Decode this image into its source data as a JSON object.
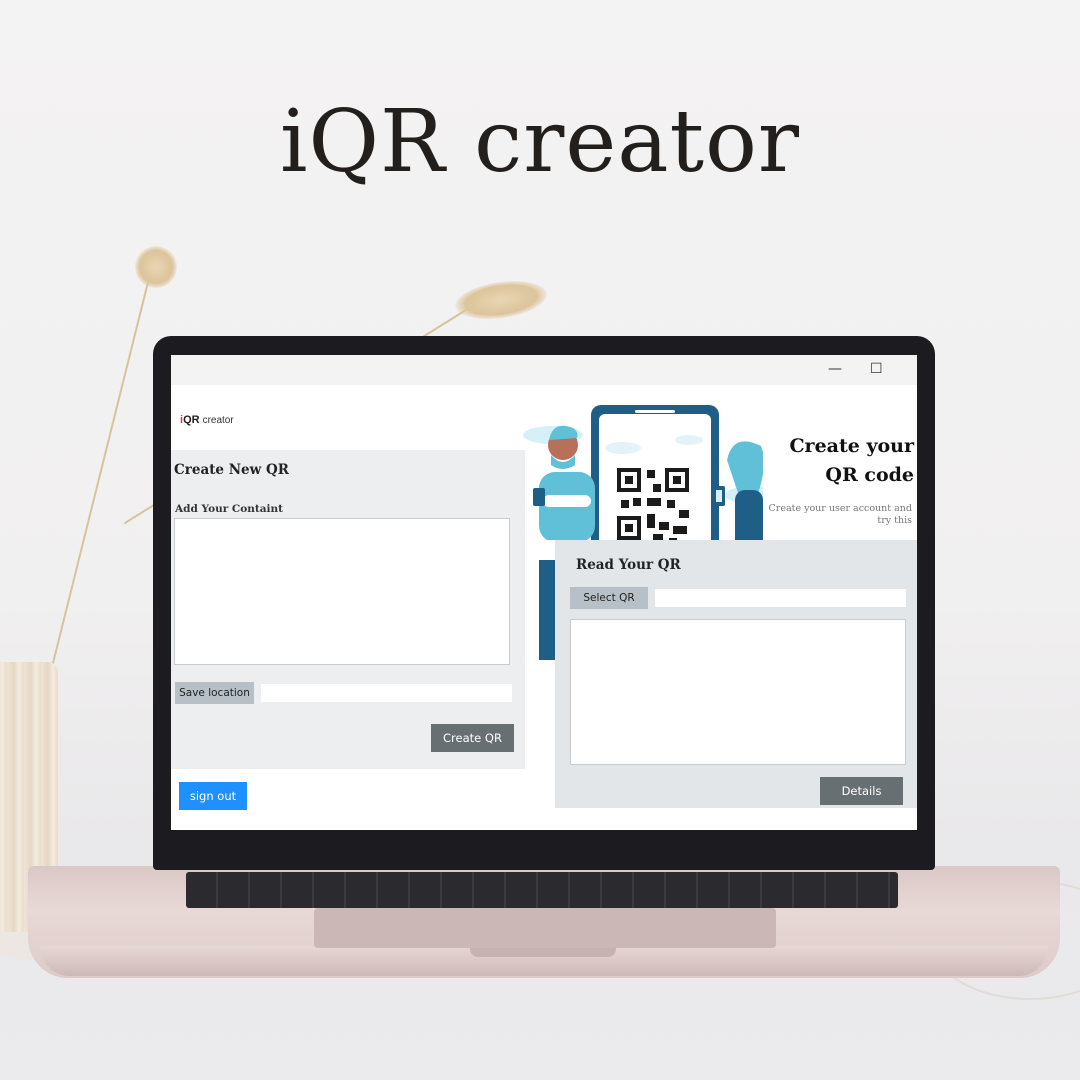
{
  "headline": "iQR creator",
  "window": {
    "minimize": "—",
    "maximize": "☐"
  },
  "logo": {
    "i": "i",
    "qr": "QR",
    "rest": "creator"
  },
  "create_panel": {
    "title": "Create New QR",
    "content_label": "Add Your Containt",
    "content_value": "",
    "save_location_button": "Save location",
    "save_location_value": "",
    "create_button": "Create  QR"
  },
  "sign_out_button": "sign out",
  "hero": {
    "title_line1": "Create your",
    "title_line2": "QR code",
    "subtitle_line1": "Create your user account and",
    "subtitle_line2": "try this"
  },
  "read_panel": {
    "title": "Read Your QR",
    "select_button": "Select QR",
    "select_value": "",
    "output_value": "",
    "details_button": "Details"
  },
  "colors": {
    "accent_blue": "#1e90ff",
    "dark_button": "#686f73",
    "grey_button": "#b7c0c7",
    "logo_red": "#e03a3e",
    "illustration_teal": "#1f5e86"
  },
  "icons": {
    "qr_illustration": "people-scanning-qr-illustration",
    "minimize": "minimize-icon",
    "maximize": "maximize-icon"
  }
}
